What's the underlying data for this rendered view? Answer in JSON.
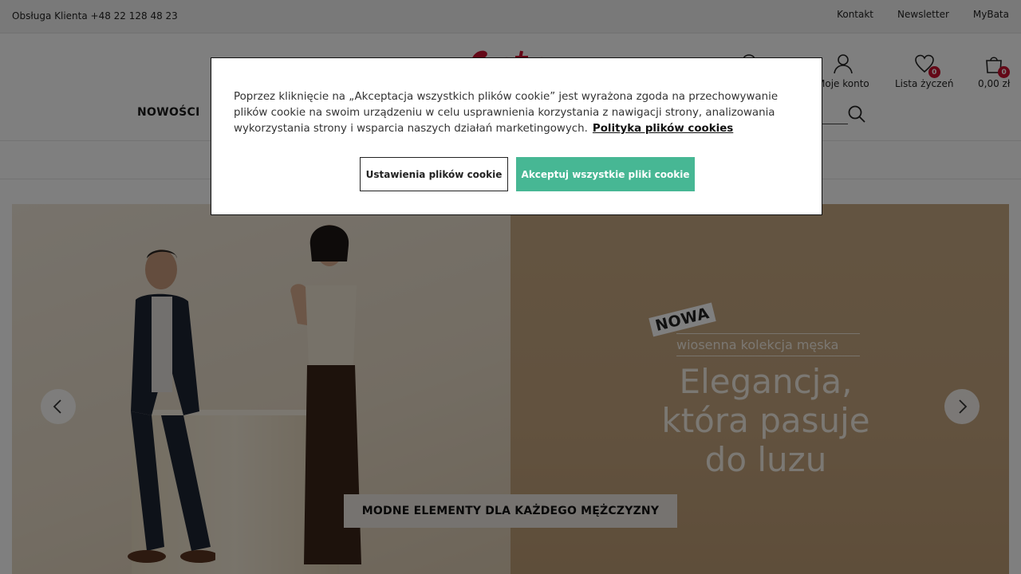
{
  "topbar": {
    "customer_service": "Obsługa Klienta +48 22 128 48 23",
    "links": [
      "Kontakt",
      "Newsletter",
      "MyBata"
    ]
  },
  "header": {
    "logo_icon": "bata-logo",
    "account_label": "Moje konto",
    "wishlist_label": "Lista życzeń",
    "wishlist_count": "0",
    "cart_total": "0,00 zł",
    "cart_count": "0",
    "nav_first": "NOWOŚCI",
    "brand_color": "#c8102e"
  },
  "hero": {
    "tag": "NOWA",
    "collection": "wiosenna kolekcja męska",
    "headline_1": "Elegancja,",
    "headline_2": "która pasuje",
    "headline_3": "do luzu",
    "promo_button": "MODNE ELEMENTY DLA KAŻDEGO MĘŻCZYZNY",
    "prev_icon": "chevron-left-icon",
    "next_icon": "chevron-right-icon"
  },
  "cookie": {
    "text": "Poprzez kliknięcie na „Akceptacja wszystkich plików cookie” jest wyrażona zgoda na przechowywanie plików cookie na swoim urządzeniu w celu usprawnienia korzystania z nawigacji strony, analizowania wykorzystania strony i wsparcia naszych działań marketingowych.",
    "policy_link": "Polityka plików cookies",
    "settings_button": "Ustawienia plików cookie",
    "accept_button": "Akceptuj wszystkie pliki cookie",
    "accept_color": "#47b794"
  }
}
